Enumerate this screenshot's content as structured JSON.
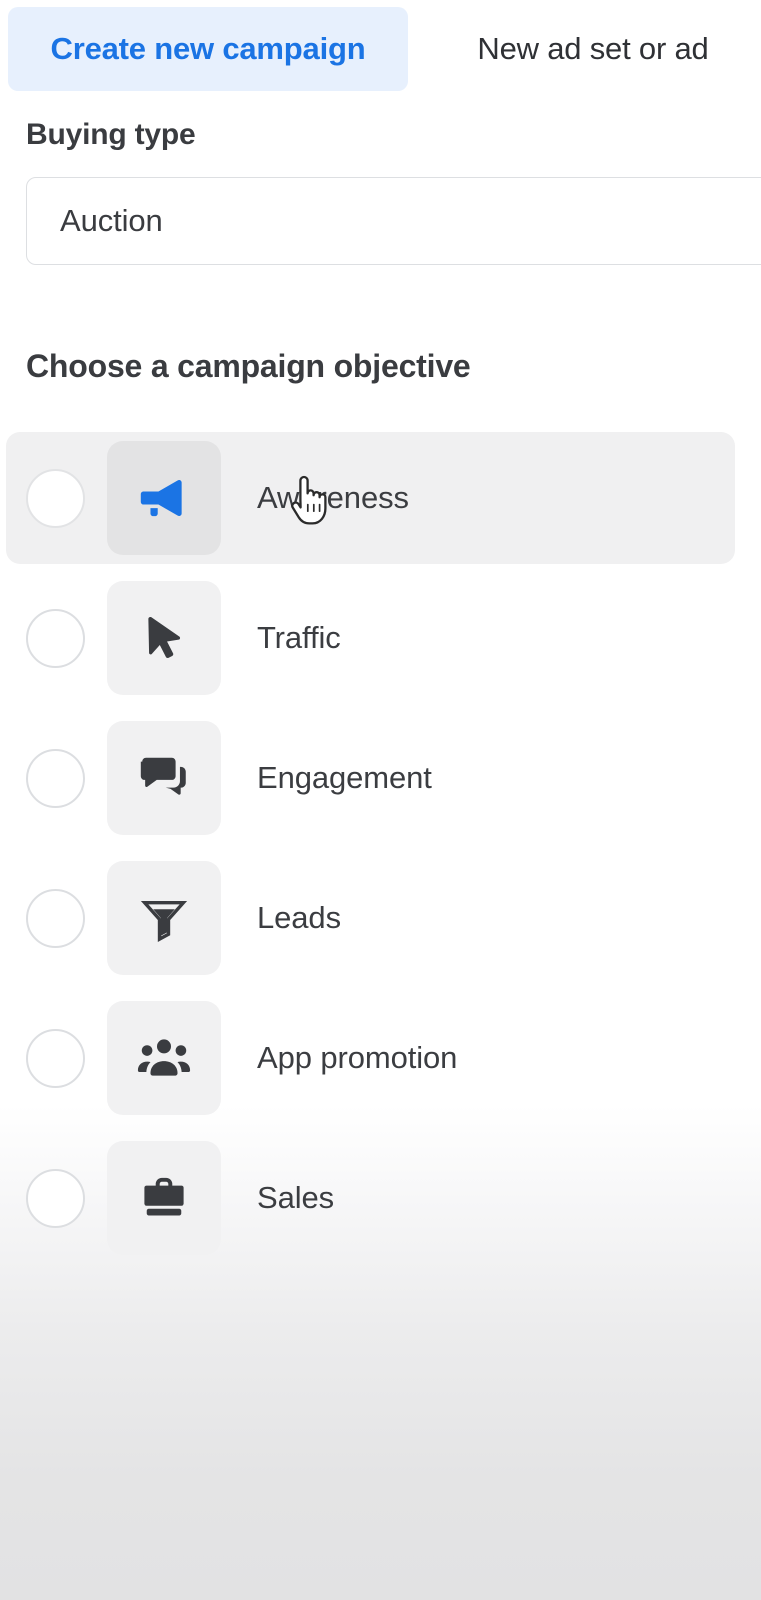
{
  "tabs": [
    {
      "label": "Create new campaign",
      "active": true
    },
    {
      "label": "New ad set or ad",
      "active": false
    }
  ],
  "buying_type": {
    "label": "Buying type",
    "selected": "Auction"
  },
  "objective_section": {
    "heading": "Choose a campaign objective"
  },
  "objectives": [
    {
      "label": "Awareness",
      "icon": "megaphone-icon",
      "selected": false,
      "hovered": true
    },
    {
      "label": "Traffic",
      "icon": "cursor-arrow-icon",
      "selected": false,
      "hovered": false
    },
    {
      "label": "Engagement",
      "icon": "speech-bubbles-icon",
      "selected": false,
      "hovered": false
    },
    {
      "label": "Leads",
      "icon": "funnel-icon",
      "selected": false,
      "hovered": false
    },
    {
      "label": "App promotion",
      "icon": "people-group-icon",
      "selected": false,
      "hovered": false
    },
    {
      "label": "Sales",
      "icon": "briefcase-icon",
      "selected": false,
      "hovered": false
    }
  ],
  "colors": {
    "accent_blue": "#1b74e4",
    "active_tab_bg": "#e7f0fd",
    "icon_dark": "#3a3c40",
    "row_hover_bg": "#f0f0f1",
    "icon_tile_bg": "#f1f1f2"
  },
  "cursor": {
    "type": "pointing-hand-cursor"
  }
}
